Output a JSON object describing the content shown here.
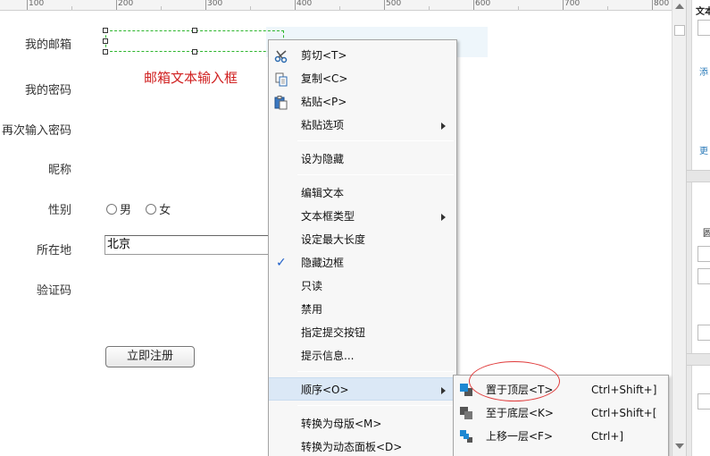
{
  "ruler": {
    "ticks": [
      "100",
      "200",
      "300",
      "400",
      "500",
      "600",
      "700",
      "800"
    ]
  },
  "form": {
    "email_label": "我的邮箱",
    "password_label": "我的密码",
    "password_confirm_label": "再次输入密码",
    "nickname_label": "昵称",
    "gender_label": "性别",
    "gender_male": "男",
    "gender_female": "女",
    "location_label": "所在地",
    "location_value": "北京",
    "captcha_label": "验证码",
    "register_button": "立即注册"
  },
  "annotation": {
    "email_box_note": "邮箱文本输入框"
  },
  "right_panel": {
    "title_fragment": "文本",
    "add_fragment": "添",
    "more_fragment": "更",
    "item_fragment": "圆"
  },
  "context_menu": {
    "cut": "剪切<T>",
    "copy": "复制<C>",
    "paste": "粘贴<P>",
    "paste_options": "粘贴选项",
    "set_hidden": "设为隐藏",
    "edit_text": "编辑文本",
    "textbox_type": "文本框类型",
    "max_length": "设定最大长度",
    "hide_border": "隐藏边框",
    "read_only": "只读",
    "disable": "禁用",
    "submit_button": "指定提交按钮",
    "tooltip": "提示信息...",
    "order": "顺序<O>",
    "to_master": "转换为母版<M>",
    "to_dynamic_panel": "转换为动态面板<D>"
  },
  "submenu": {
    "bring_to_front": "置于顶层<T>",
    "bring_to_front_shortcut": "Ctrl+Shift+]",
    "send_to_back": "至于底层<K>",
    "send_to_back_shortcut": "Ctrl+Shift+[",
    "bring_forward": "上移一层<F>",
    "bring_forward_shortcut": "Ctrl+]"
  },
  "colors": {
    "menu_highlight": "#dbe8f6",
    "annotation_red": "#e03a3a",
    "selection_green": "#2cb52c",
    "check_blue": "#1f5fc8"
  }
}
